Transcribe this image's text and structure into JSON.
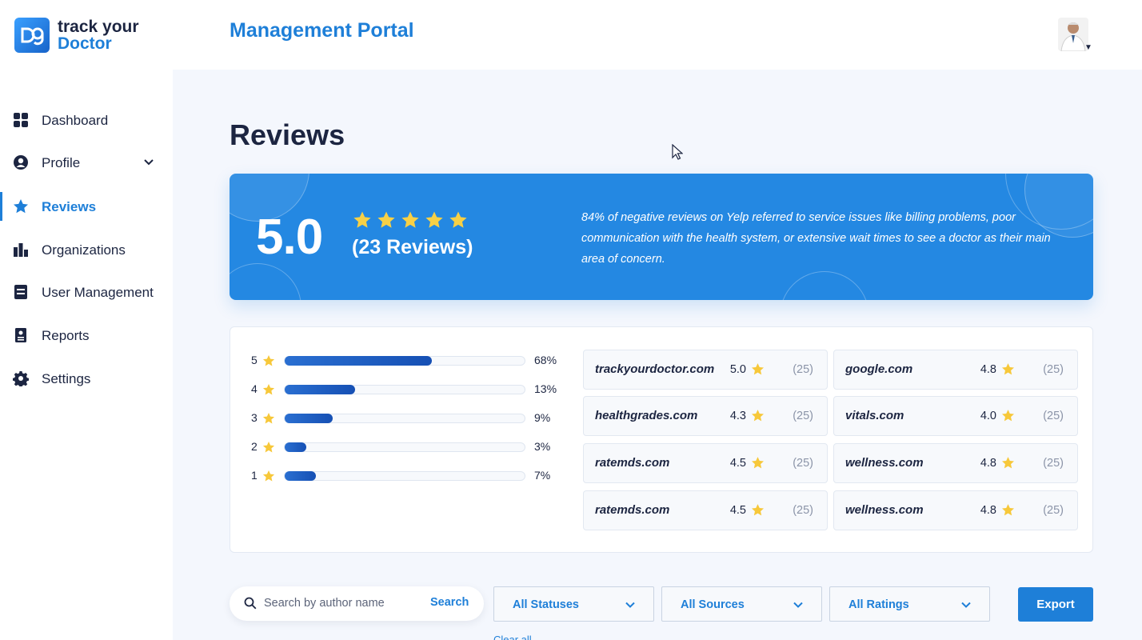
{
  "app": {
    "logo_line1": "track your",
    "logo_line2": "Doctor",
    "portal_title": "Management Portal",
    "accent_color": "#1e7fd8"
  },
  "sidebar": {
    "items": [
      {
        "label": "Dashboard",
        "icon": "grid-icon"
      },
      {
        "label": "Profile",
        "icon": "user-circle-icon",
        "expandable": true
      },
      {
        "label": "Reviews",
        "icon": "star-icon",
        "active": true
      },
      {
        "label": "Organizations",
        "icon": "bar-chart-icon"
      },
      {
        "label": "User Management",
        "icon": "document-icon"
      },
      {
        "label": "Reports",
        "icon": "report-icon"
      },
      {
        "label": "Settings",
        "icon": "gear-icon"
      }
    ]
  },
  "page": {
    "title": "Reviews"
  },
  "summary": {
    "score": "5.0",
    "stars": 5,
    "reviews_text": "(23 Reviews)",
    "note": "84% of negative reviews on Yelp referred to service issues like billing problems, poor communication with the health system, or extensive wait times to see a doctor as their main area of concern."
  },
  "rating_breakdown": [
    {
      "stars": "5",
      "percent_label": "68%",
      "fill": 0.61
    },
    {
      "stars": "4",
      "percent_label": "13%",
      "fill": 0.29
    },
    {
      "stars": "3",
      "percent_label": "9%",
      "fill": 0.2
    },
    {
      "stars": "2",
      "percent_label": "3%",
      "fill": 0.09
    },
    {
      "stars": "1",
      "percent_label": "7%",
      "fill": 0.13
    }
  ],
  "sources": [
    {
      "name": "trackyourdoctor.com",
      "score": "5.0",
      "count": "(25)"
    },
    {
      "name": "google.com",
      "score": "4.8",
      "count": "(25)"
    },
    {
      "name": "healthgrades.com",
      "score": "4.3",
      "count": "(25)"
    },
    {
      "name": "vitals.com",
      "score": "4.0",
      "count": "(25)"
    },
    {
      "name": "ratemds.com",
      "score": "4.5",
      "count": "(25)"
    },
    {
      "name": "wellness.com",
      "score": "4.8",
      "count": "(25)"
    },
    {
      "name": "ratemds.com",
      "score": "4.5",
      "count": "(25)"
    },
    {
      "name": "wellness.com",
      "score": "4.8",
      "count": "(25)"
    }
  ],
  "filters": {
    "search_placeholder": "Search by author name",
    "search_value": "",
    "search_button": "Search",
    "status": "All Statuses",
    "source": "All Sources",
    "rating": "All Ratings",
    "export": "Export",
    "clear_all": "Clear all"
  }
}
